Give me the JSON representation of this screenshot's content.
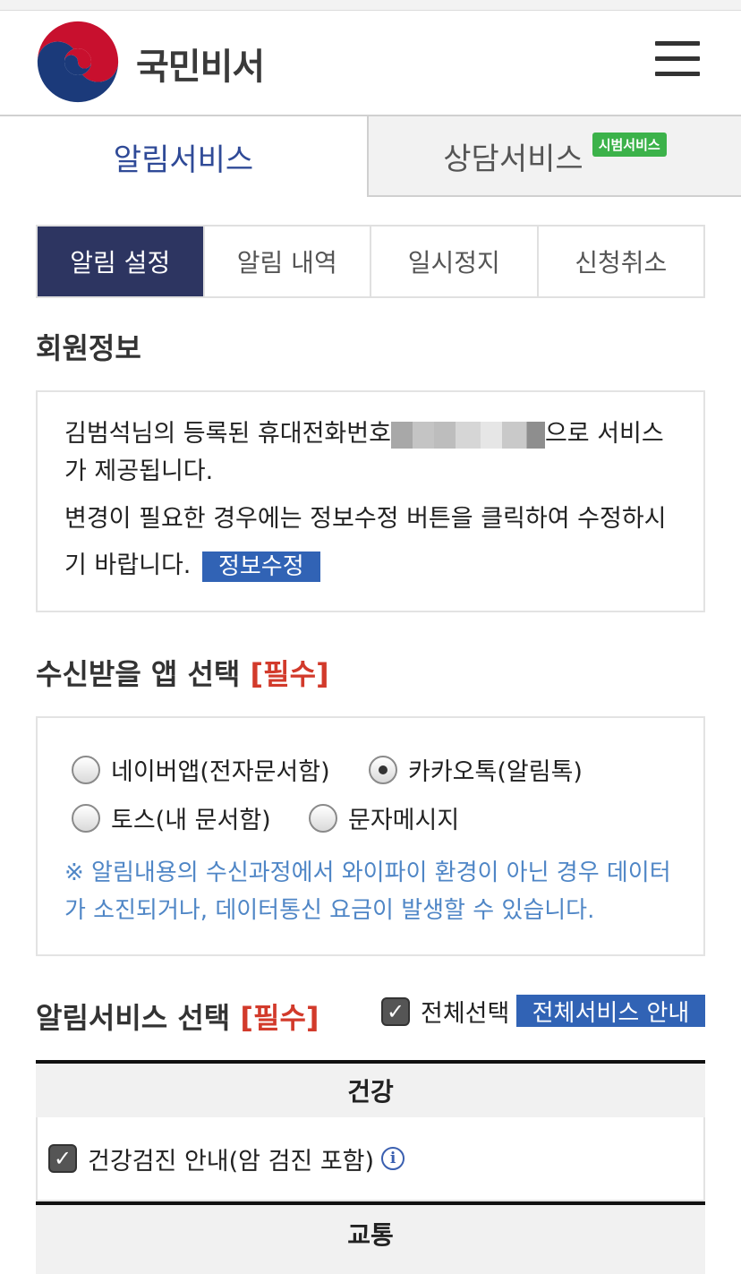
{
  "header": {
    "brand": "국민비서",
    "menu_icon": "hamburger-menu-icon"
  },
  "main_tabs": [
    {
      "label": "알림서비스",
      "active": true
    },
    {
      "label": "상담서비스",
      "active": false,
      "badge": "시범서비스"
    }
  ],
  "sub_tabs": [
    {
      "label": "알림 설정",
      "active": true
    },
    {
      "label": "알림 내역",
      "active": false
    },
    {
      "label": "일시정지",
      "active": false
    },
    {
      "label": "신청취소",
      "active": false
    }
  ],
  "member_info": {
    "title": "회원정보",
    "line1_before": "김범석님의 등록된 휴대전화번호",
    "line1_after": "으로 서비스가 제공됩니다.",
    "line2": "변경이 필요한 경우에는 정보수정 버튼을 클릭하여 수정하시기 바랍니다.",
    "edit_button": "정보수정"
  },
  "app_select": {
    "title": "수신받을 앱 선택",
    "required": "[필수]",
    "options": [
      {
        "label": "네이버앱(전자문서함)",
        "checked": false
      },
      {
        "label": "카카오톡(알림톡)",
        "checked": true
      },
      {
        "label": "토스(내 문서함)",
        "checked": false
      },
      {
        "label": "문자메시지",
        "checked": false
      }
    ],
    "note": "※ 알림내용의 수신과정에서 와이파이 환경이 아닌 경우 데이터가 소진되거나, 데이터통신 요금이 발생할 수 있습니다."
  },
  "service_select": {
    "title": "알림서비스 선택",
    "required": "[필수]",
    "select_all_label": "전체선택",
    "select_all_checked": true,
    "guide_button": "전체서비스 안내",
    "categories": [
      {
        "name": "건강",
        "items": [
          {
            "label": "건강검진 안내(암 검진 포함)",
            "checked": true
          }
        ]
      },
      {
        "name": "교통",
        "items": []
      }
    ]
  },
  "colors": {
    "primary_navy": "#2d3561",
    "tab_blue": "#2f4a97",
    "button_blue": "#3163b5",
    "required_red": "#d23a2b",
    "note_blue": "#4f86c6",
    "badge_green": "#3cb24a"
  }
}
